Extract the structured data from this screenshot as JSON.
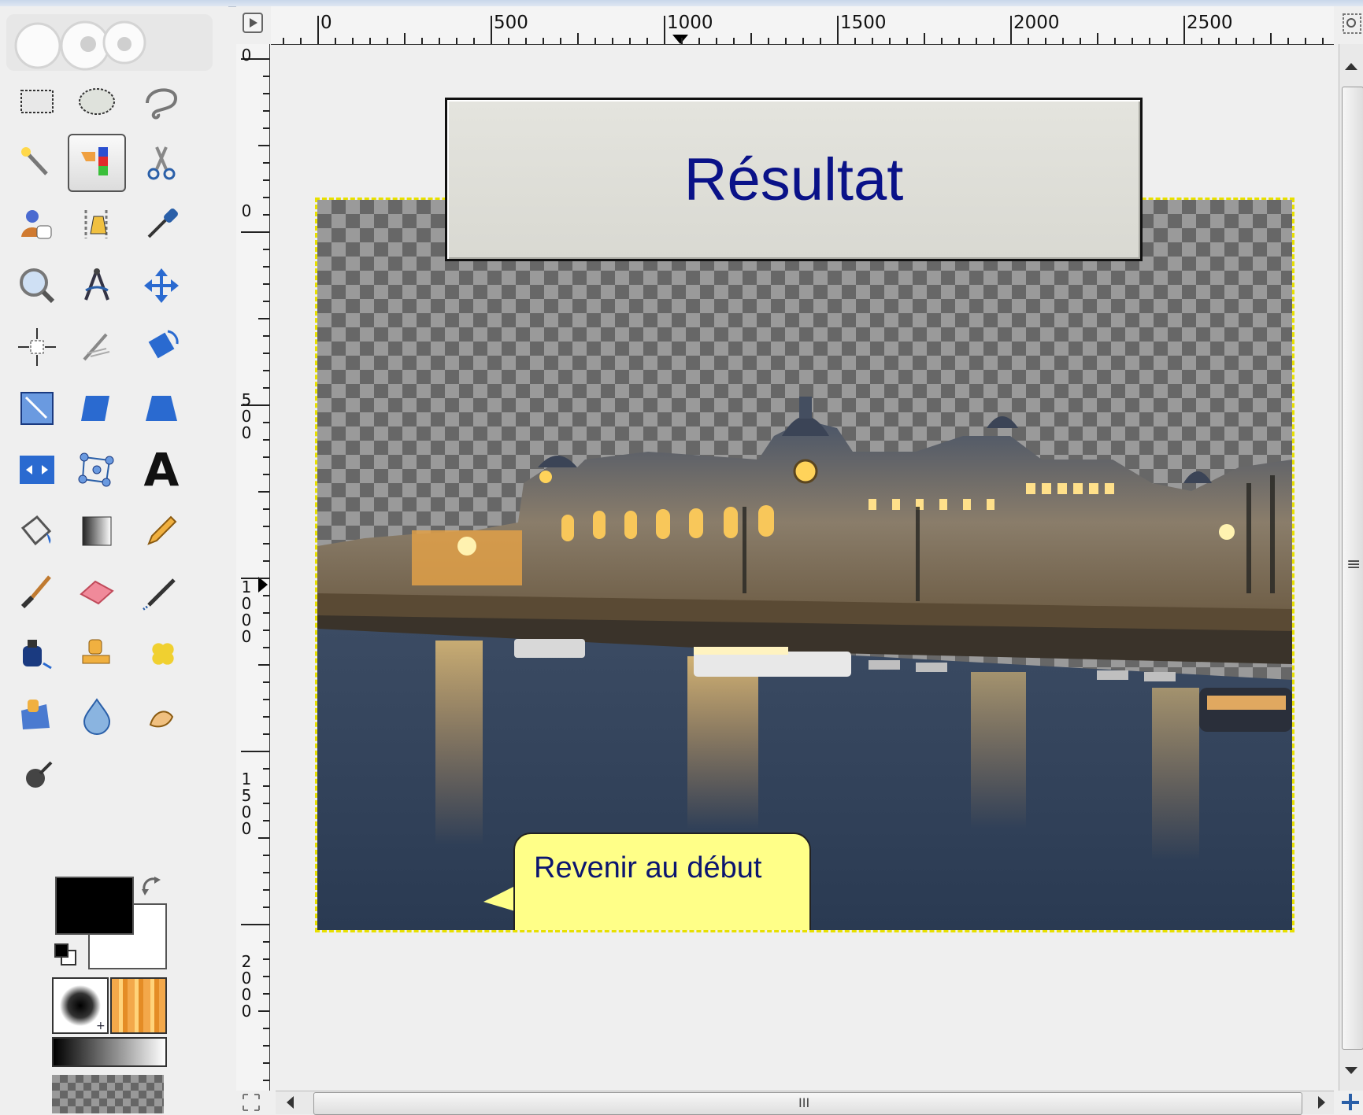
{
  "window": {
    "title": ""
  },
  "toolbox": {
    "tools": [
      {
        "name": "rect-select-icon"
      },
      {
        "name": "ellipse-select-icon"
      },
      {
        "name": "free-select-icon"
      },
      {
        "name": "fuzzy-select-icon"
      },
      {
        "name": "select-by-color-icon",
        "active": true
      },
      {
        "name": "scissors-select-icon"
      },
      {
        "name": "foreground-select-icon"
      },
      {
        "name": "paths-icon"
      },
      {
        "name": "color-picker-icon"
      },
      {
        "name": "zoom-icon"
      },
      {
        "name": "measure-icon"
      },
      {
        "name": "move-icon"
      },
      {
        "name": "align-icon"
      },
      {
        "name": "crop-icon"
      },
      {
        "name": "rotate-icon"
      },
      {
        "name": "scale-icon"
      },
      {
        "name": "shear-icon"
      },
      {
        "name": "perspective-icon"
      },
      {
        "name": "flip-icon"
      },
      {
        "name": "cage-transform-icon"
      },
      {
        "name": "text-icon"
      },
      {
        "name": "bucket-fill-icon"
      },
      {
        "name": "blend-icon"
      },
      {
        "name": "pencil-icon"
      },
      {
        "name": "paintbrush-icon"
      },
      {
        "name": "eraser-icon"
      },
      {
        "name": "airbrush-icon"
      },
      {
        "name": "ink-icon"
      },
      {
        "name": "clone-icon"
      },
      {
        "name": "heal-icon"
      },
      {
        "name": "perspective-clone-icon"
      },
      {
        "name": "blur-sharpen-icon"
      },
      {
        "name": "smudge-icon"
      },
      {
        "name": "dodge-burn-icon"
      }
    ],
    "text_tool_glyph": "A",
    "colors": {
      "foreground": "#000000",
      "background": "#ffffff"
    }
  },
  "rulers": {
    "horizontal_labels": [
      "0",
      "500",
      "1000",
      "1500",
      "2000",
      "2500"
    ],
    "vertical_labels": [
      "0",
      "0",
      "500",
      "1000",
      "1500",
      "2000"
    ],
    "vertical_label_top": [
      "0",
      "0"
    ]
  },
  "canvas": {
    "title_button_text": "Résultat",
    "callout_text": "Revenir au début",
    "selection_color": "#e8e000",
    "title_color": "#0a1288",
    "callout_bg": "#ffff88"
  },
  "scrollbars": {
    "grip_glyph": "III",
    "vgrip_glyph": "≡"
  }
}
